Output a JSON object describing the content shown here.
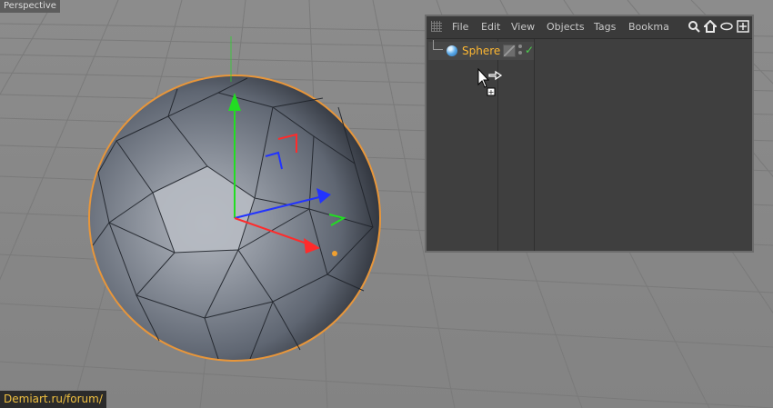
{
  "viewport": {
    "label": "Perspective",
    "object": "sphere",
    "colors": {
      "background": "#8a8a8a",
      "selection_outline": "#e8963a",
      "axis_x": "#ff2b2b",
      "axis_y": "#22dd22",
      "axis_z": "#2233ff"
    }
  },
  "object_manager": {
    "menu": [
      "File",
      "Edit",
      "View",
      "Objects",
      "Tags",
      "Bookma"
    ],
    "toolbar_icons": [
      "search-icon",
      "home-icon",
      "eye-icon",
      "maximize-icon"
    ],
    "objects": [
      {
        "name": "Sphere",
        "icon": "sphere-icon",
        "layer_icon": "layer-icon",
        "visibility_dots": true,
        "enabled": "✓"
      }
    ]
  },
  "cursor": {
    "icon": "move-copy-cursor",
    "sign": "+"
  },
  "watermark": "Demiart.ru/forum/"
}
